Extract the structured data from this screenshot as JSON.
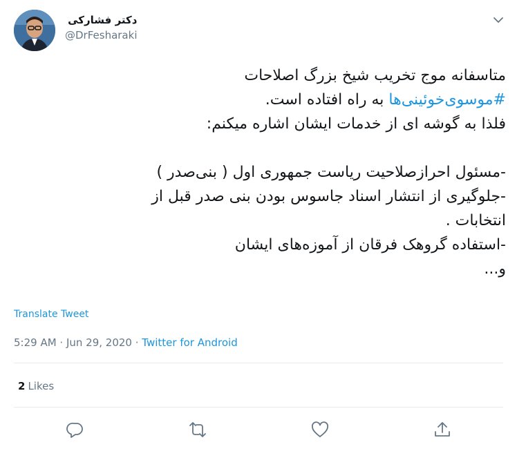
{
  "user": {
    "display_name": "دکتر فشارکی",
    "handle": "@DrFesharaki"
  },
  "tweet": {
    "line1": "متاسفانه موج تخریب شیخ بزرگ اصلاحات",
    "line2_hashtag": "#موسوی‌خوئینی‌ها",
    "line2_rest": " به راه افتاده است.",
    "line3": "فلذا به گوشه ای از خدمات ایشان اشاره میکنم:",
    "line5": "-مسئول احرازصلاحیت ریاست جمهوری اول ( بنی‌صدر )",
    "line6": "-جلوگیری از انتشار اسناد جاسوس بودن بنی صدر قبل از",
    "line7": "انتخابات .",
    "line8": "-استفاده گروهک فرقان از آموزه‌های ایشان",
    "line9": "و..."
  },
  "translate_label": "Translate Tweet",
  "meta": {
    "time": "5:29 AM",
    "separator": " · ",
    "date": "Jun 29, 2020",
    "source": "Twitter for Android"
  },
  "stats": {
    "likes_count": "2",
    "likes_label": "Likes"
  },
  "icons": {
    "avatar": "avatar-photo",
    "caret": "chevron-down-icon",
    "reply": "reply-icon",
    "retweet": "retweet-icon",
    "like": "heart-icon",
    "share": "share-icon"
  },
  "colors": {
    "link": "#1b95e0",
    "text": "#14171a",
    "muted": "#657786",
    "divider": "#e6ecf0"
  }
}
